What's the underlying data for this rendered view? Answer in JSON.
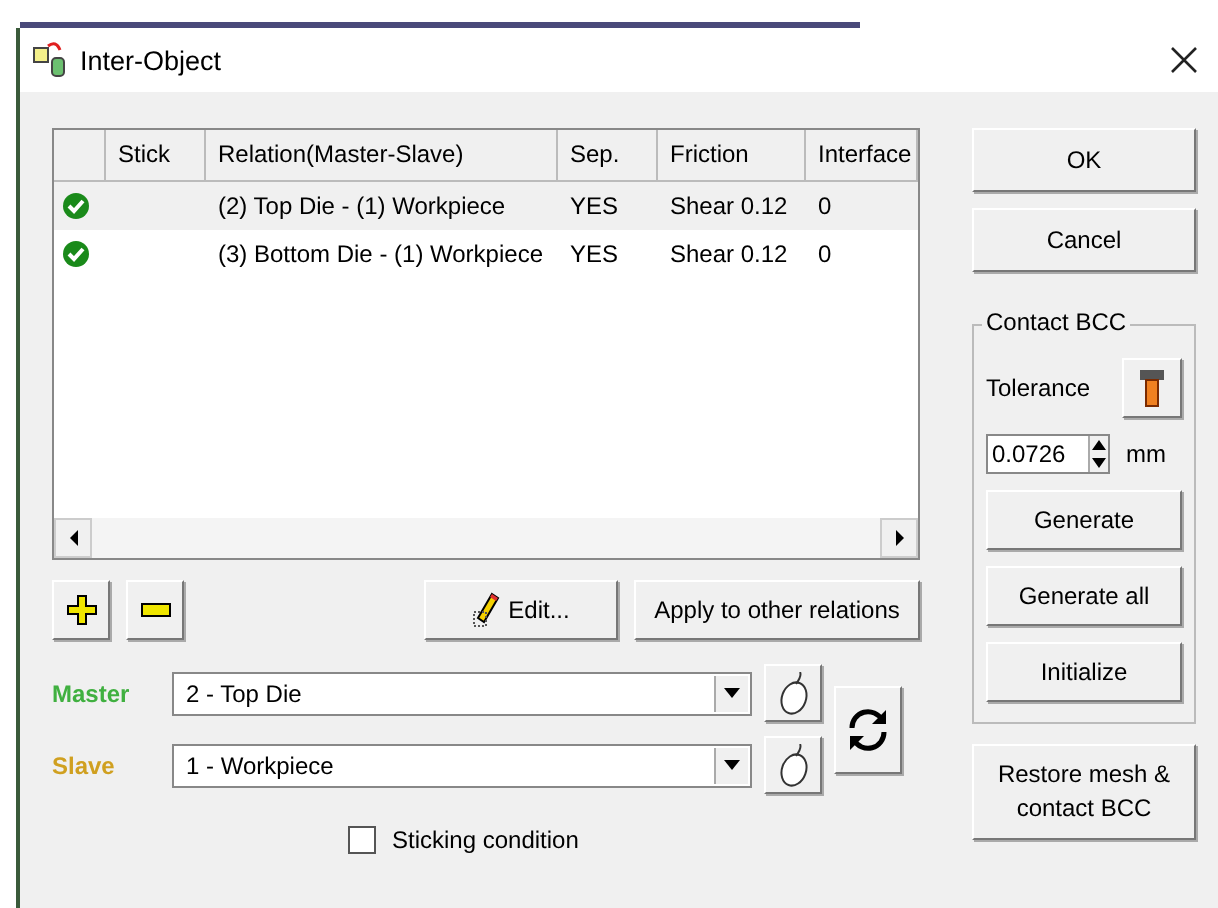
{
  "window": {
    "title": "Inter-Object"
  },
  "table": {
    "columns": [
      "Stick",
      "Relation(Master-Slave)",
      "Sep.",
      "Friction",
      "Interface"
    ],
    "rows": [
      {
        "checked": true,
        "relation": "(2) Top Die - (1) Workpiece",
        "sep": "YES",
        "friction": "Shear 0.12",
        "interface": "0",
        "selected": true
      },
      {
        "checked": true,
        "relation": "(3) Bottom Die - (1) Workpiece",
        "sep": "YES",
        "friction": "Shear 0.12",
        "interface": "0",
        "selected": false
      }
    ]
  },
  "buttons": {
    "edit": "Edit...",
    "apply": "Apply to other relations",
    "ok": "OK",
    "cancel": "Cancel"
  },
  "master": {
    "label": "Master",
    "value": "2 - Top Die"
  },
  "slave": {
    "label": "Slave",
    "value": "1 - Workpiece"
  },
  "sticking": {
    "label": "Sticking condition",
    "checked": false
  },
  "contact_bcc": {
    "title": "Contact BCC",
    "tolerance_label": "Tolerance",
    "tolerance": "0.0726",
    "unit": "mm",
    "buttons": [
      "Generate",
      "Generate all",
      "Initialize"
    ]
  },
  "restore": "Restore mesh & contact BCC"
}
